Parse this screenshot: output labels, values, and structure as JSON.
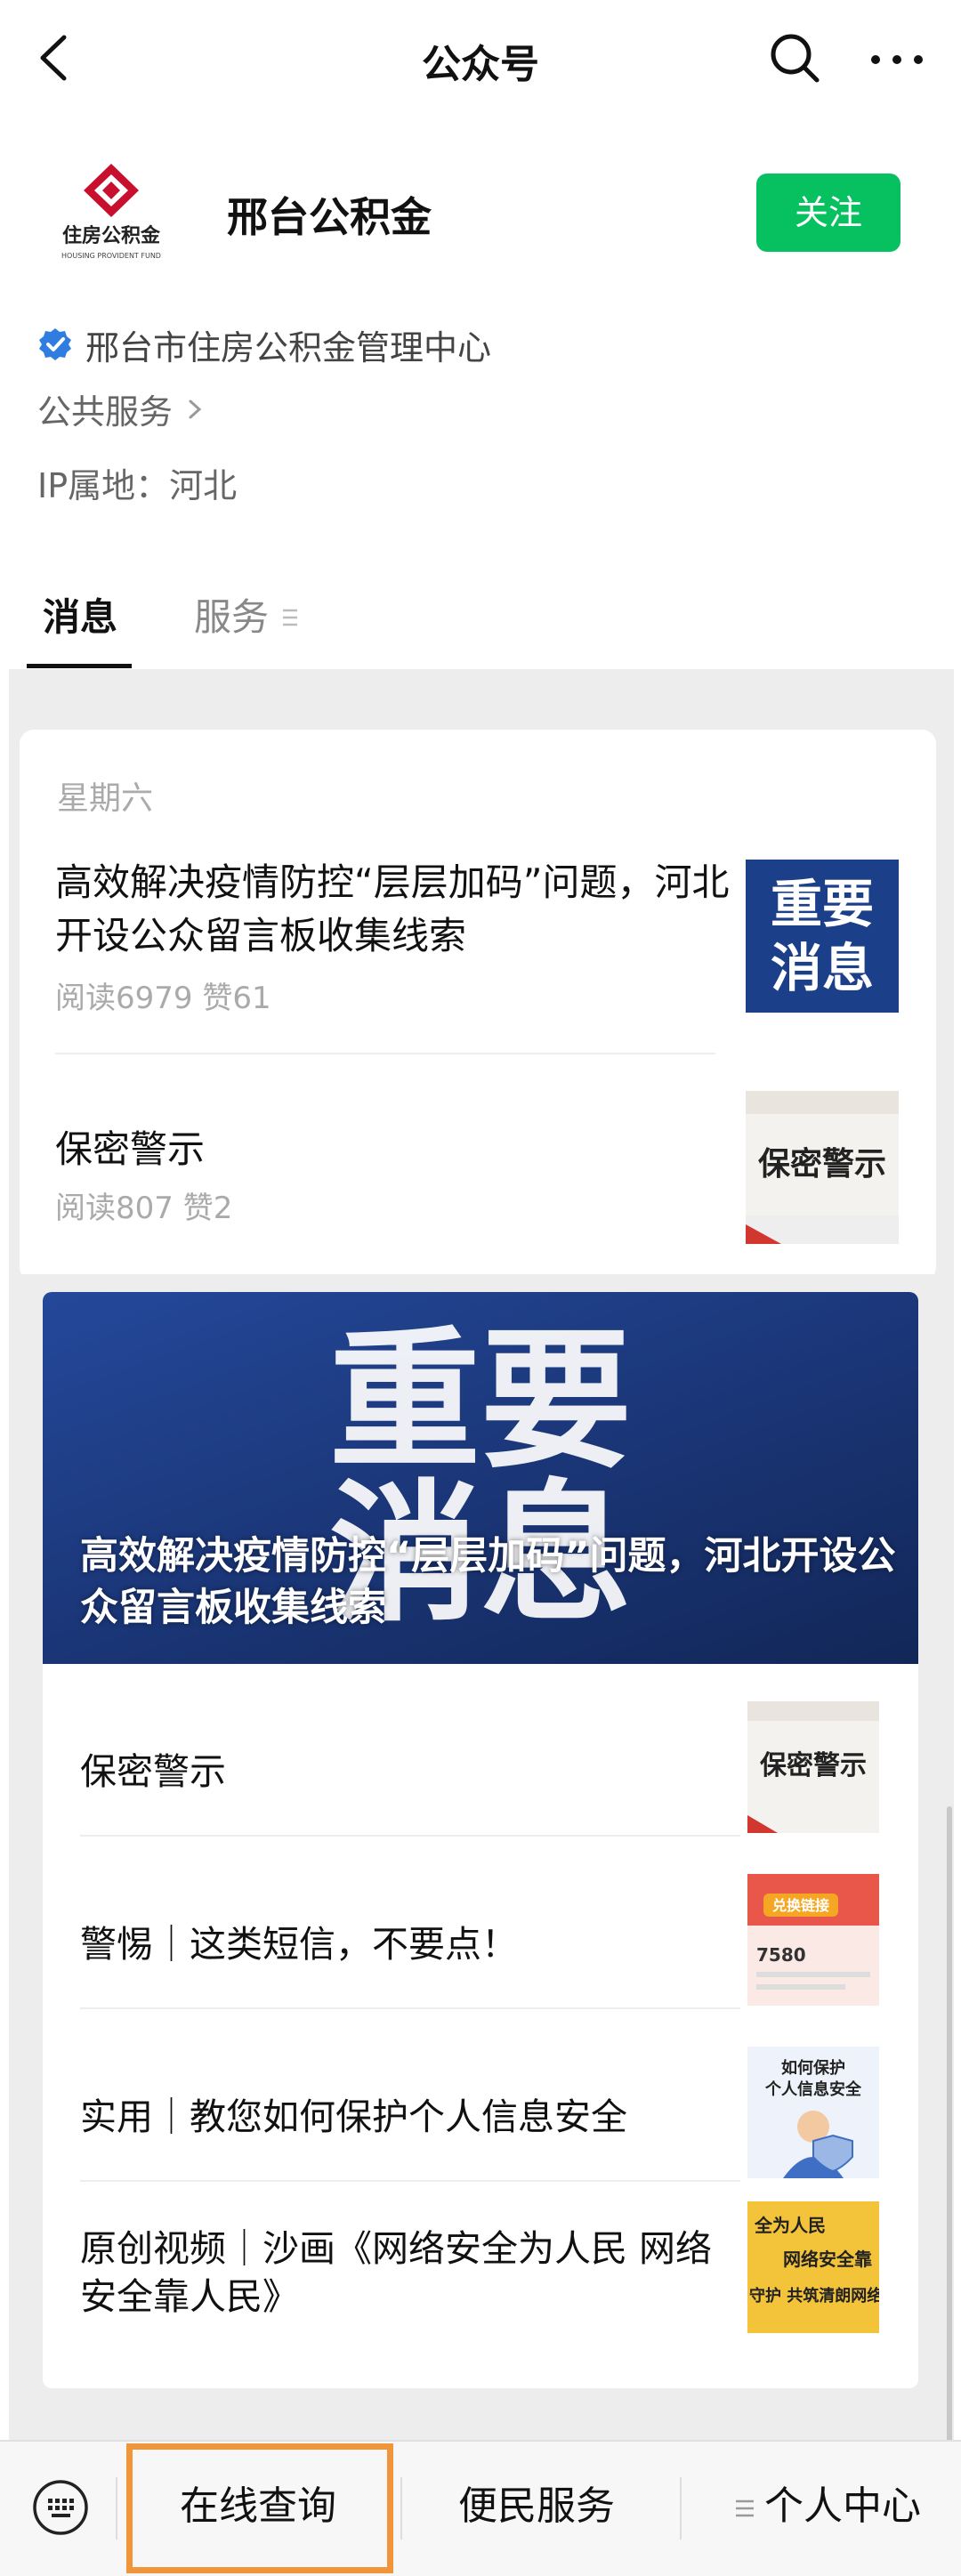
{
  "nav": {
    "title": "公众号"
  },
  "account": {
    "name": "邢台公积金",
    "follow_label": "关注",
    "logo_text": "住房公积金",
    "logo_subtext": "HOUSING PROVIDENT FUND",
    "verified_org": "邢台市住房公积金管理中心",
    "category": "公共服务",
    "ip_location": "IP属地：河北"
  },
  "tabs": [
    {
      "label": "消息"
    },
    {
      "label": "服务"
    }
  ],
  "messages": {
    "day": "星期六",
    "articles": [
      {
        "title": "高效解决疫情防控“层层加码”问题，河北开设公众留言板收集线索",
        "meta": "阅读6979  赞61",
        "thumb_text": "重要消息"
      },
      {
        "title": "保密警示",
        "meta": "阅读807  赞2",
        "thumb_text": "保密警示"
      }
    ]
  },
  "menu": {
    "banner_big": "重要消息",
    "banner_title": "高效解决疫情防控“层层加码”问题，河北开设公众留言板收集线索",
    "items": [
      {
        "label": "保密警示",
        "thumb_text": "保密警示"
      },
      {
        "label": "警惕｜这类短信，不要点！",
        "thumb_text": "兑换链接 7580"
      },
      {
        "label": "实用｜教您如何保护个人信息安全",
        "thumb_text": "如何保护个人信息安全"
      },
      {
        "label": "原创视频｜沙画《网络安全为人民 网络安全靠人民》",
        "thumb_text": "全为人民 网络安全靠 守护 共筑清朗网络"
      }
    ]
  },
  "bottom_bar": {
    "items": [
      {
        "label": "在线查询"
      },
      {
        "label": "便民服务"
      },
      {
        "label": "个人中心"
      }
    ]
  },
  "colors": {
    "follow_green": "#07c160",
    "highlight_orange": "#f0953a",
    "banner_blue": "#1c3f8a",
    "verify_blue": "#2f7de1"
  }
}
